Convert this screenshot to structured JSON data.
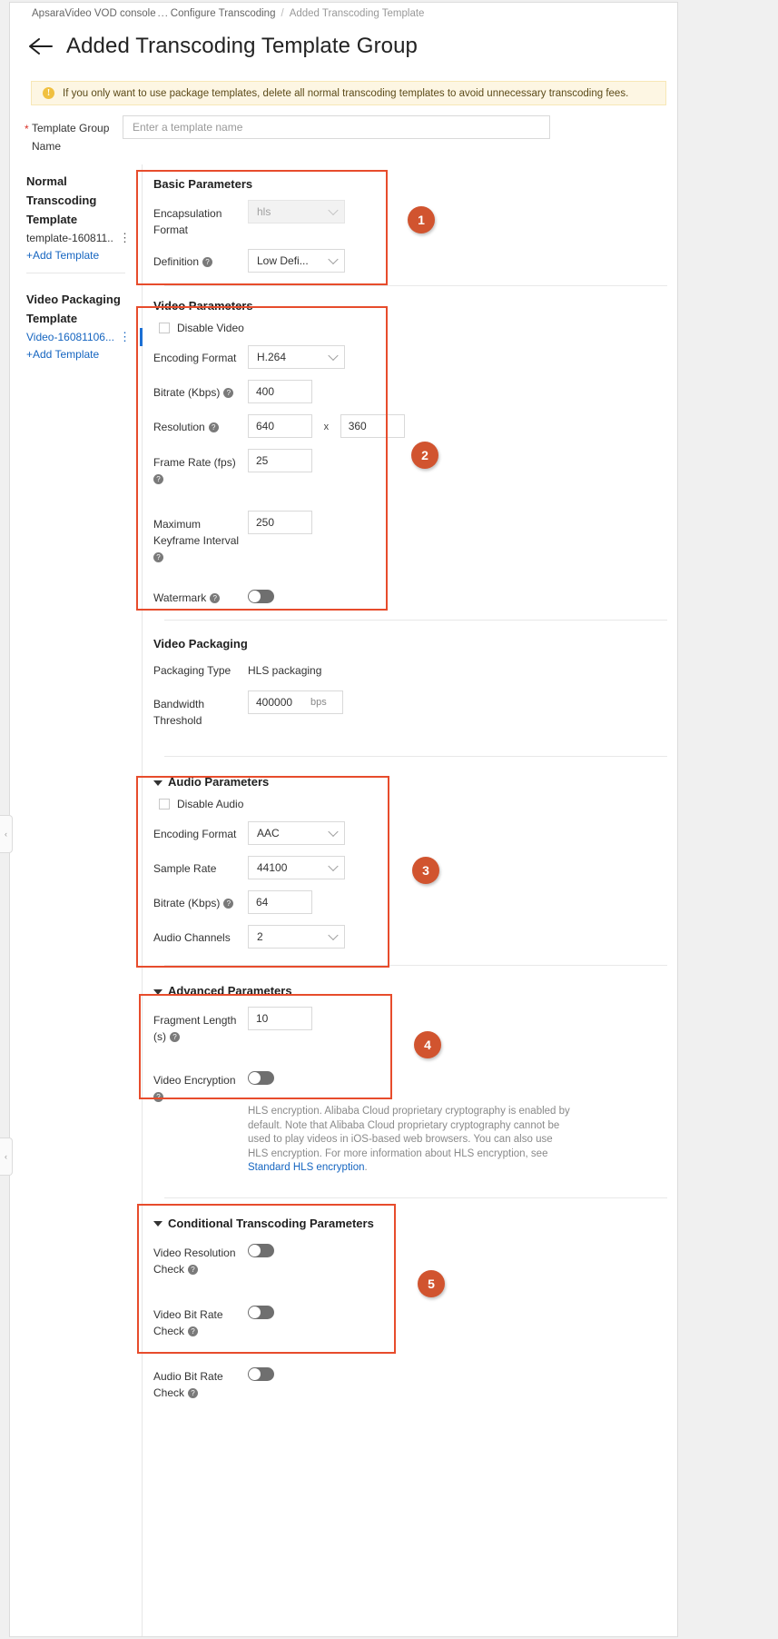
{
  "breadcrumb": {
    "items": [
      "ApsaraVideo VOD console",
      "Configure Transcoding",
      "Added Transcoding Template"
    ],
    "ellipsis": "...",
    "separator": "/"
  },
  "header": {
    "title": "Added Transcoding Template Group",
    "back_icon": "arrow-left-icon"
  },
  "alert": {
    "icon": "exclamation-icon",
    "text": "If you only want to use package templates, delete all normal transcoding templates to avoid unnecessary transcoding fees."
  },
  "template_group": {
    "label": "Template Group Name",
    "required_marker": "*",
    "placeholder": "Enter a template name",
    "value": ""
  },
  "sidebar": {
    "groups": [
      {
        "title": "Normal Transcoding Template",
        "items": [
          {
            "label": "template-160811...",
            "link": false,
            "active": false
          }
        ],
        "add_label": "+Add Template"
      },
      {
        "title": "Video Packaging Template",
        "items": [
          {
            "label": "Video-16081106...",
            "link": true,
            "active": true
          }
        ],
        "add_label": "+Add Template"
      }
    ],
    "more_icon": "kebab-menu-icon"
  },
  "basic_parameters": {
    "title": "Basic Parameters",
    "encapsulation_format": {
      "label": "Encapsulation Format",
      "value": "hls",
      "disabled": true
    },
    "definition": {
      "label": "Definition",
      "value": "Low Defi...",
      "help": "?"
    }
  },
  "video_parameters": {
    "title": "Video Parameters",
    "disable_video": {
      "label": "Disable Video",
      "checked": false
    },
    "encoding_format": {
      "label": "Encoding Format",
      "value": "H.264"
    },
    "bitrate": {
      "label": "Bitrate (Kbps)",
      "value": "400",
      "help": "?"
    },
    "resolution": {
      "label": "Resolution",
      "width": "640",
      "height": "360",
      "separator": "x",
      "help": "?"
    },
    "frame_rate": {
      "label": "Frame Rate (fps)",
      "value": "25",
      "help": "?"
    },
    "keyframe_interval": {
      "label": "Maximum Keyframe Interval",
      "value": "250",
      "help": "?"
    },
    "watermark": {
      "label": "Watermark",
      "enabled": false,
      "help": "?"
    }
  },
  "video_packaging": {
    "title": "Video Packaging",
    "packaging_type": {
      "label": "Packaging Type",
      "value": "HLS packaging"
    },
    "bandwidth_threshold": {
      "label": "Bandwidth Threshold",
      "value": "400000",
      "unit": "bps"
    }
  },
  "audio_parameters": {
    "title": "Audio Parameters",
    "disable_audio": {
      "label": "Disable Audio",
      "checked": false
    },
    "encoding_format": {
      "label": "Encoding Format",
      "value": "AAC"
    },
    "sample_rate": {
      "label": "Sample Rate",
      "value": "44100"
    },
    "bitrate": {
      "label": "Bitrate (Kbps)",
      "value": "64",
      "help": "?"
    },
    "audio_channels": {
      "label": "Audio Channels",
      "value": "2"
    }
  },
  "advanced_parameters": {
    "title": "Advanced Parameters",
    "fragment_length": {
      "label": "Fragment Length (s)",
      "value": "10",
      "help": "?"
    },
    "video_encryption": {
      "label": "Video Encryption",
      "enabled": false,
      "help": "?"
    },
    "note_text": "HLS encryption. Alibaba Cloud proprietary cryptography is enabled by default. Note that Alibaba Cloud proprietary cryptography cannot be used to play videos in iOS-based web browsers. You can also use HLS encryption. For more information about HLS encryption, see ",
    "note_link": "Standard HLS encryption",
    "note_end": "."
  },
  "conditional_parameters": {
    "title": "Conditional Transcoding Parameters",
    "video_resolution_check": {
      "label": "Video Resolution Check",
      "enabled": false,
      "help": "?"
    },
    "video_bit_rate_check": {
      "label": "Video Bit Rate Check",
      "enabled": false,
      "help": "?"
    },
    "audio_bit_rate_check": {
      "label": "Audio Bit Rate Check",
      "enabled": false,
      "help": "?"
    }
  },
  "callouts": {
    "numbers": [
      "1",
      "2",
      "3",
      "4",
      "5"
    ]
  }
}
